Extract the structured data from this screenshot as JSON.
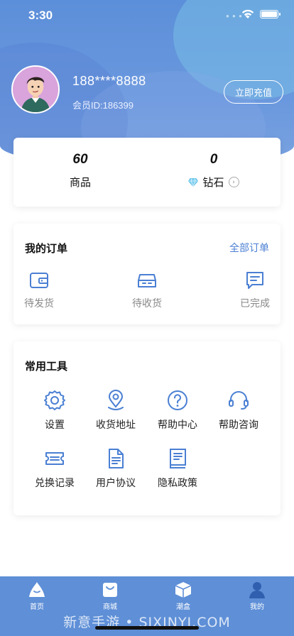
{
  "status": {
    "time": "3:30"
  },
  "user": {
    "phone": "188****8888",
    "member_id": "会员ID:186399"
  },
  "header": {
    "recharge_label": "立即充值"
  },
  "stats": [
    {
      "value": "60",
      "label": "商品"
    },
    {
      "value": "0",
      "label": "钻石"
    }
  ],
  "orders": {
    "title": "我的订单",
    "all_label": "全部订单",
    "items": [
      {
        "label": "待发货",
        "icon": "wallet-icon"
      },
      {
        "label": "待收货",
        "icon": "inbox-icon"
      },
      {
        "label": "已完成",
        "icon": "message-icon"
      }
    ]
  },
  "tools": {
    "title": "常用工具",
    "items": [
      {
        "label": "设置",
        "icon": "gear-icon"
      },
      {
        "label": "收货地址",
        "icon": "location-icon"
      },
      {
        "label": "帮助中心",
        "icon": "question-icon"
      },
      {
        "label": "帮助咨询",
        "icon": "headset-icon"
      },
      {
        "label": "兑换记录",
        "icon": "ticket-icon"
      },
      {
        "label": "用户协议",
        "icon": "document-icon"
      },
      {
        "label": "隐私政策",
        "icon": "book-icon"
      }
    ]
  },
  "tabbar": {
    "items": [
      {
        "label": "首页",
        "icon": "home-icon"
      },
      {
        "label": "商城",
        "icon": "shopping-bag-icon"
      },
      {
        "label": "潮盒",
        "icon": "box-icon"
      },
      {
        "label": "我的",
        "icon": "profile-icon"
      }
    ]
  },
  "watermark": "新意手游 • SJXINYI.COM",
  "colors": {
    "accent": "#4a7fd3",
    "hero": "#5c8fd9",
    "tabbar": "#5e8fd7"
  }
}
